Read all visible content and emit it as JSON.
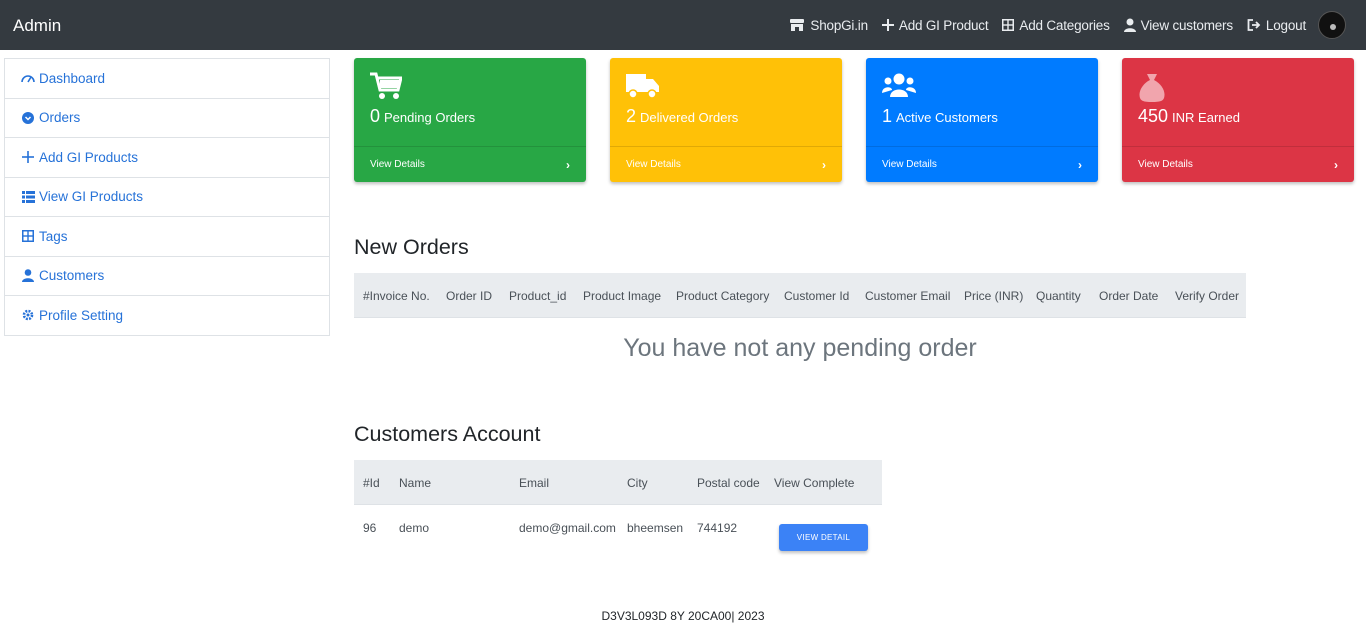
{
  "navbar": {
    "brand": "Admin",
    "links": [
      {
        "label": "ShopGi.in",
        "icon": "store-icon"
      },
      {
        "label": "Add GI Product",
        "icon": "plus-icon"
      },
      {
        "label": "Add Categories",
        "icon": "grid-icon"
      },
      {
        "label": "View customers",
        "icon": "user-icon"
      },
      {
        "label": "Logout",
        "icon": "logout-icon"
      }
    ]
  },
  "sidebar": {
    "items": [
      {
        "label": "Dashboard",
        "icon": "speedometer-icon"
      },
      {
        "label": "Orders",
        "icon": "chevron-circle-down-icon"
      },
      {
        "label": "Add GI Products",
        "icon": "plus-icon"
      },
      {
        "label": "View GI Products",
        "icon": "list-icon"
      },
      {
        "label": "Tags",
        "icon": "table-icon"
      },
      {
        "label": "Customers",
        "icon": "user-icon"
      },
      {
        "label": "Profile Setting",
        "icon": "gear-icon"
      }
    ]
  },
  "cards": [
    {
      "value": "0",
      "label": "Pending Orders",
      "footer": "View Details",
      "color": "#28a745",
      "icon": "cart-icon"
    },
    {
      "value": "2",
      "label": "Delivered Orders",
      "footer": "View Details",
      "color": "#ffc107",
      "icon": "truck-icon"
    },
    {
      "value": "1",
      "label": "Active Customers",
      "footer": "View Details",
      "color": "#007bff",
      "icon": "users-icon"
    },
    {
      "value": "450",
      "label": "INR Earned",
      "footer": "View Details",
      "color": "#dc3545",
      "icon": "money-bag-icon"
    }
  ],
  "new_orders": {
    "title": "New Orders",
    "columns": [
      "#Invoice No.",
      "Order ID",
      "Product_id",
      "Product Image",
      "Product Category",
      "Customer Id",
      "Customer Email",
      "Price (INR)",
      "Quantity",
      "Order Date",
      "Verify Order"
    ],
    "empty_message": "You have not any pending order"
  },
  "customers": {
    "title": "Customers Account",
    "columns": [
      "#Id",
      "Name",
      "Email",
      "City",
      "Postal code",
      "View Complete"
    ],
    "rows": [
      {
        "id": "96",
        "name": "demo",
        "email": "demo@gmail.com",
        "city": "bheemsen",
        "postal": "744192",
        "action": "VIEW DETAIL"
      }
    ]
  },
  "footer": "D3V3L093D 8Y 20CA00| 2023"
}
